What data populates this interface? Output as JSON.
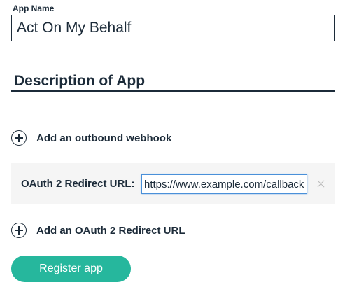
{
  "app_name": {
    "label": "App Name",
    "value": "Act On My Behalf"
  },
  "description": {
    "heading": "Description of App"
  },
  "webhook": {
    "add_label": "Add an outbound webhook",
    "icon": "plus-circle-icon"
  },
  "oauth": {
    "label": "OAuth 2 Redirect URL:",
    "value": "https://www.example.com/callback",
    "remove_icon": "close-icon",
    "add_label": "Add an OAuth 2 Redirect URL",
    "add_icon": "plus-circle-icon"
  },
  "actions": {
    "register_label": "Register app"
  },
  "colors": {
    "text": "#1c2b39",
    "accent": "#26b79d",
    "input_focus": "#4a90d9",
    "panel_bg": "#f5f5f5"
  }
}
